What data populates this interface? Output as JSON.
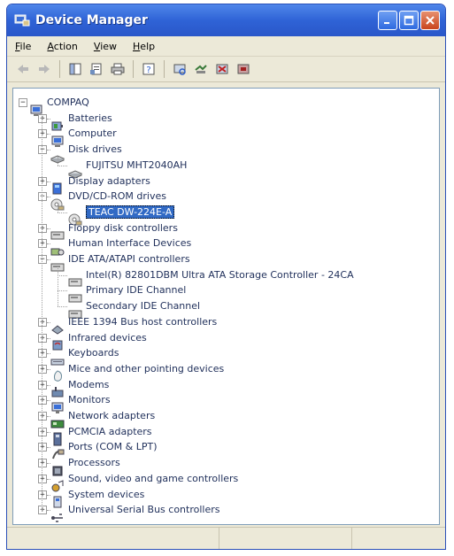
{
  "window": {
    "title": "Device Manager"
  },
  "menu": [
    {
      "label": "File",
      "key": "F",
      "rest": "ile"
    },
    {
      "label": "Action",
      "key": "A",
      "rest": "ction"
    },
    {
      "label": "View",
      "key": "V",
      "rest": "iew"
    },
    {
      "label": "Help",
      "key": "H",
      "rest": "elp"
    }
  ],
  "toolbar": [
    "back-icon",
    "forward-icon",
    "properties-icon",
    "print-icon",
    "refresh-icon",
    "help-icon",
    "update-driver-icon",
    "scan-hardware-icon",
    "disable-device-icon",
    "uninstall-device-icon"
  ],
  "tree": {
    "root": "COMPAQ",
    "nodes": [
      {
        "label": "Batteries",
        "icon": "battery-icon",
        "expanded": false
      },
      {
        "label": "Computer",
        "icon": "computer-icon",
        "expanded": false
      },
      {
        "label": "Disk drives",
        "icon": "disk-drive-icon",
        "expanded": true,
        "children": [
          {
            "label": "FUJITSU MHT2040AH",
            "icon": "disk-drive-icon"
          }
        ]
      },
      {
        "label": "Display adapters",
        "icon": "display-adapter-icon",
        "expanded": false
      },
      {
        "label": "DVD/CD-ROM drives",
        "icon": "cdrom-icon",
        "expanded": true,
        "children": [
          {
            "label": "TEAC DW-224E-A",
            "icon": "cdrom-icon",
            "selected": true
          }
        ]
      },
      {
        "label": "Floppy disk controllers",
        "icon": "controller-icon",
        "expanded": false
      },
      {
        "label": "Human Interface Devices",
        "icon": "hid-icon",
        "expanded": false
      },
      {
        "label": "IDE ATA/ATAPI controllers",
        "icon": "controller-icon",
        "expanded": true,
        "children": [
          {
            "label": "Intel(R) 82801DBM Ultra ATA Storage Controller - 24CA",
            "icon": "controller-icon"
          },
          {
            "label": "Primary IDE Channel",
            "icon": "controller-icon"
          },
          {
            "label": "Secondary IDE Channel",
            "icon": "controller-icon"
          }
        ]
      },
      {
        "label": "IEEE 1394 Bus host controllers",
        "icon": "ieee1394-icon",
        "expanded": false
      },
      {
        "label": "Infrared devices",
        "icon": "infrared-icon",
        "expanded": false
      },
      {
        "label": "Keyboards",
        "icon": "keyboard-icon",
        "expanded": false
      },
      {
        "label": "Mice and other pointing devices",
        "icon": "mouse-icon",
        "expanded": false
      },
      {
        "label": "Modems",
        "icon": "modem-icon",
        "expanded": false
      },
      {
        "label": "Monitors",
        "icon": "monitor-icon",
        "expanded": false
      },
      {
        "label": "Network adapters",
        "icon": "network-adapter-icon",
        "expanded": false
      },
      {
        "label": "PCMCIA adapters",
        "icon": "pcmcia-icon",
        "expanded": false
      },
      {
        "label": "Ports (COM & LPT)",
        "icon": "port-icon",
        "expanded": false
      },
      {
        "label": "Processors",
        "icon": "processor-icon",
        "expanded": false
      },
      {
        "label": "Sound, video and game controllers",
        "icon": "sound-icon",
        "expanded": false
      },
      {
        "label": "System devices",
        "icon": "system-device-icon",
        "expanded": false
      },
      {
        "label": "Universal Serial Bus controllers",
        "icon": "usb-icon",
        "expanded": false
      }
    ]
  },
  "colors": {
    "title_bar": "#2f63d6",
    "selection": "#316ac5",
    "chrome": "#ECE9D8"
  }
}
